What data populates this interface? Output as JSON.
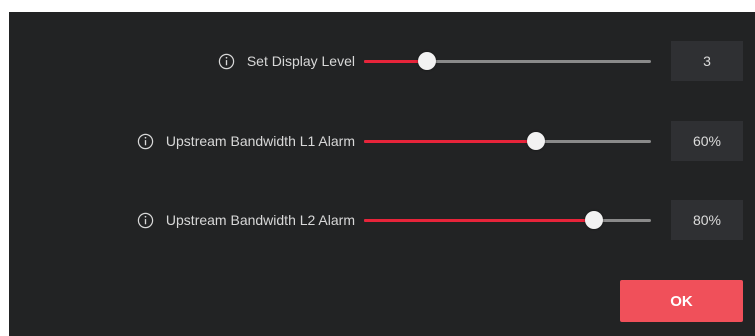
{
  "settings": [
    {
      "label": "Set Display Level",
      "value": "3",
      "level": 0.22,
      "icon": "info-circle-icon"
    },
    {
      "label": "Upstream Bandwidth L1 Alarm",
      "value": "60%",
      "level": 0.6,
      "icon": "info-circle-icon"
    },
    {
      "label": "Upstream Bandwidth L2 Alarm",
      "value": "80%",
      "level": 0.8,
      "icon": "info-circle-icon"
    }
  ],
  "ok_label": "OK",
  "colors": {
    "panel_background": "#222324",
    "accent": "#e8243a",
    "ok_button": "#f0505a"
  }
}
